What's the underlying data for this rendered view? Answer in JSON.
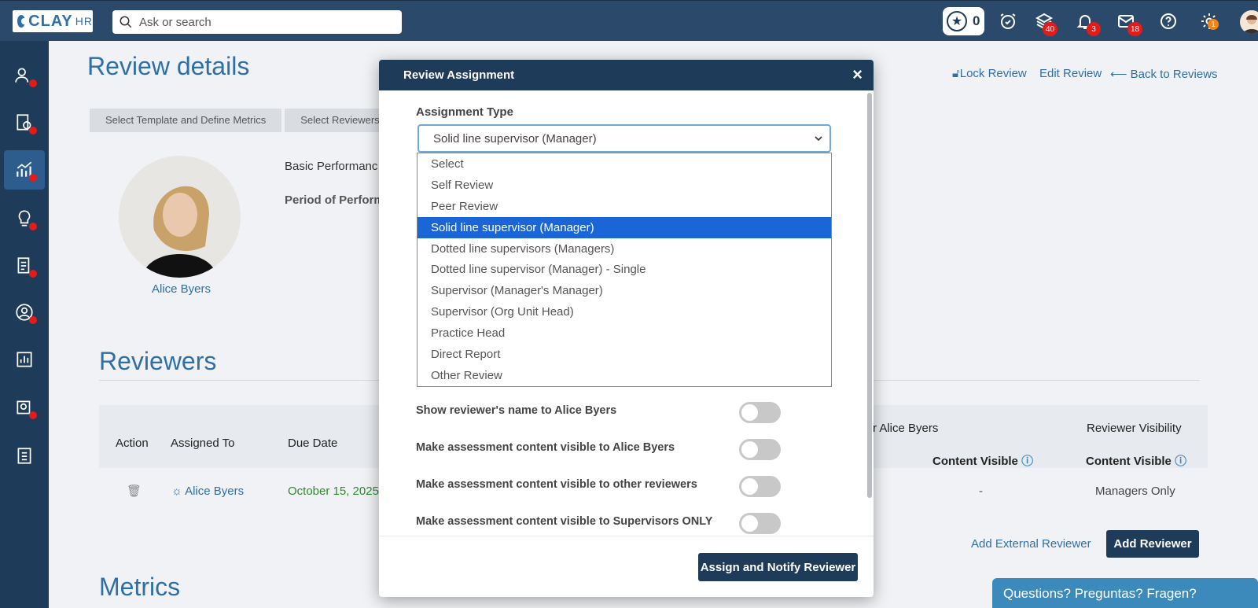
{
  "search": {
    "placeholder": "Ask or search"
  },
  "header": {
    "star_count": "0",
    "badges": {
      "layers": "40",
      "bell": "3",
      "mail": "18",
      "settings": "1"
    }
  },
  "page": {
    "title": "Review details",
    "links": {
      "lock": "Lock Review",
      "edit": "Edit Review",
      "back": "Back to Reviews"
    },
    "steps": [
      "Select Template and Define Metrics",
      "Select Reviewers"
    ],
    "employee_name": "Alice Byers",
    "basic_label": "Basic Performanc",
    "period_label": "Period of Perform",
    "reviewers_heading": "Reviewers",
    "metrics_heading": "Metrics",
    "table": {
      "col_action": "Action",
      "col_assigned_to": "Assigned To",
      "col_due_date": "Due Date",
      "col_for": "r Alice Byers",
      "col_visibility": "Reviewer Visibility",
      "sub_content_visible_1": "Content Visible",
      "sub_content_visible_2": "Content Visible",
      "row_assignee": "Alice Byers",
      "row_due": "October 15, 2025",
      "row_dash": "-",
      "row_visibility": "Managers Only"
    },
    "add_external": "Add External Reviewer",
    "add_reviewer": "Add Reviewer",
    "help": "Questions? Preguntas? Fragen?"
  },
  "modal": {
    "title": "Review Assignment",
    "close": "×",
    "assignment_type_label": "Assignment Type",
    "selected_value": "Solid line supervisor (Manager)",
    "options": [
      "Select",
      "Self Review",
      "Peer Review",
      "Solid line supervisor (Manager)",
      "Dotted line supervisors (Managers)",
      "Dotted line supervisor (Manager) - Single",
      "Supervisor (Manager's Manager)",
      "Supervisor (Org Unit Head)",
      "Practice Head",
      "Direct Report",
      "Other Review"
    ],
    "toggles": [
      "Show reviewer's name to Alice Byers",
      "Make assessment content visible to Alice Byers",
      "Make assessment content visible to other reviewers",
      "Make assessment content visible to Supervisors ONLY"
    ],
    "submit": "Assign and Notify Reviewer"
  },
  "colors": {
    "navy": "#1f3b5a",
    "accent": "#2f6fa8",
    "selected": "#1a66d6",
    "badge": "#e31b1b"
  }
}
